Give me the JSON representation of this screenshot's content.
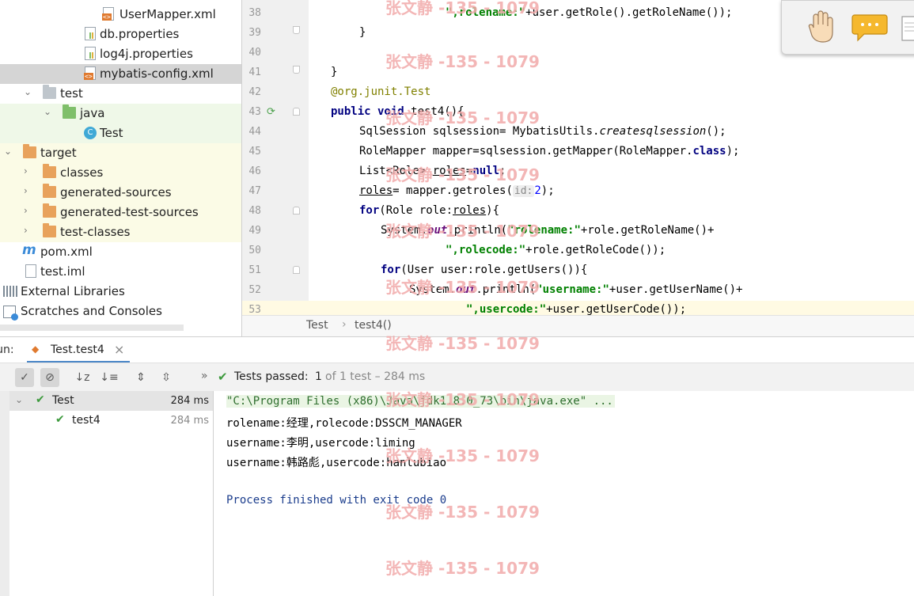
{
  "project_tree": {
    "items": [
      {
        "label": "UserMapper.xml",
        "type": "xml"
      },
      {
        "label": "db.properties",
        "type": "properties"
      },
      {
        "label": "log4j.properties",
        "type": "properties"
      },
      {
        "label": "mybatis-config.xml",
        "type": "xml"
      },
      {
        "label": "test",
        "type": "folder"
      },
      {
        "label": "java",
        "type": "folder"
      },
      {
        "label": "Test",
        "type": "class"
      },
      {
        "label": "target",
        "type": "folder"
      },
      {
        "label": "classes",
        "type": "folder"
      },
      {
        "label": "generated-sources",
        "type": "folder"
      },
      {
        "label": "generated-test-sources",
        "type": "folder"
      },
      {
        "label": "test-classes",
        "type": "folder"
      },
      {
        "label": "pom.xml",
        "type": "maven"
      },
      {
        "label": "test.iml",
        "type": "iml"
      },
      {
        "label": "External Libraries",
        "type": "libraries"
      },
      {
        "label": "Scratches and Consoles",
        "type": "scratches"
      }
    ],
    "selected": "mybatis-config.xml",
    "class_icon_letter": "C",
    "maven_icon_letter": "m",
    "xml_badge": "<>"
  },
  "editor": {
    "line_numbers": [
      "38",
      "39",
      "40",
      "41",
      "42",
      "43",
      "44",
      "45",
      "46",
      "47",
      "48",
      "49",
      "50",
      "51",
      "52",
      "53"
    ],
    "code": {
      "l38_str": "\",rolename:\"",
      "l38_rest": "+user.getRole().getRoleName());",
      "l39": "}",
      "l41": "}",
      "l42_ann": "@org.junit.",
      "l42_cls": "Test",
      "l43_kw": "public void",
      "l43_rest": " test4(){",
      "l44_a": "SqlSession sqlsession= MybatisUtils.",
      "l44_it": "createsqlsession",
      "l44_b": "();",
      "l45_a": "RoleMapper mapper=sqlsession.getMapper(RoleMapper.",
      "l45_kw": "class",
      "l45_b": ");",
      "l46_a": "List<Role> ",
      "l46_ul": "roles",
      "l46_b": "=",
      "l46_kw": "null",
      "l46_c": ";",
      "l47_ul": "roles",
      "l47_a": "= mapper.getroles(",
      "l47_hint": "id:",
      "l47_num": "2",
      "l47_b": ");",
      "l48_kw": "for",
      "l48_a": "(Role role:",
      "l48_ul": "roles",
      "l48_b": "){",
      "l49_a": "System.",
      "l49_fld": "out",
      "l49_b": ".println(",
      "l49_str": "\"rolename:\"",
      "l49_c": "+role.getRoleName()+",
      "l50_str": "\",rolecode:\"",
      "l50_a": "+role.getRoleCode());",
      "l51_kw": "for",
      "l51_a": "(User user:role.getUsers()){",
      "l52_a": "System.",
      "l52_fld": "out",
      "l52_b": ".println(",
      "l52_str": "\"username:\"",
      "l52_c": "+user.getUserName()+",
      "l53_str": "\",usercode:\"",
      "l53_a": "+user.getUserCode());"
    },
    "breadcrumb": [
      "Test",
      "test4()"
    ],
    "breadcrumb_sep": "›"
  },
  "run_panel": {
    "tab_prefix": "Run:",
    "tab_label": "Test.test4",
    "close_glyph": "×",
    "status_text": "Tests passed:",
    "status_count": "1",
    "status_detail": "of 1 test – 284 ms",
    "more_glyph": "»",
    "tree": [
      {
        "label": "Test",
        "time": "284 ms"
      },
      {
        "label": "test4",
        "time": "284 ms"
      }
    ],
    "console": {
      "cmd": "\"C:\\Program Files (x86)\\Java\\jdk1.8.0_73\\bin\\java.exe\" ...",
      "lines": [
        "rolename:经理,rolecode:DSSCM_MANAGER",
        "username:李明,usercode:liming",
        "username:韩路彪,usercode:hanlubiao"
      ],
      "finished": "Process finished with exit code 0"
    }
  },
  "watermark": {
    "text": "张文静 -135 - 1079",
    "color": "#f2aaaa"
  },
  "colors": {
    "keyword": "#000080",
    "string": "#008000",
    "annotation": "#808000",
    "field": "#660e7a",
    "number": "#0000ff",
    "pass_green": "#3d9a3d",
    "selection": "#d5d5d5",
    "cmd_highlight": "#eaf5e4"
  }
}
